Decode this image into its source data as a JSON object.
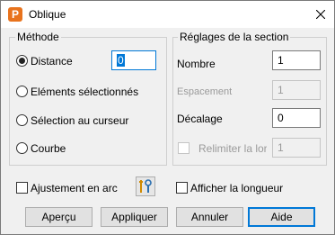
{
  "window": {
    "title": "Oblique",
    "icon_letter": "P"
  },
  "methode": {
    "title": "Méthode",
    "options": [
      {
        "label": "Distance",
        "checked": true
      },
      {
        "label": "Eléments sélectionnés",
        "checked": false
      },
      {
        "label": "Sélection au curseur",
        "checked": false
      },
      {
        "label": "Courbe",
        "checked": false
      }
    ],
    "distance_value": "0"
  },
  "reglages": {
    "title": "Réglages de la section",
    "nombre_label": "Nombre",
    "nombre_value": "1",
    "espacement_label": "Espacement",
    "espacement_value": "1",
    "decalage_label": "Décalage",
    "decalage_value": "0",
    "relimiter_label": "Relimiter la lor",
    "relimiter_value": "1"
  },
  "options": {
    "ajustement_label": "Ajustement en arc",
    "afficher_label": "Afficher la longueur"
  },
  "buttons": {
    "apercu": "Aperçu",
    "appliquer": "Appliquer",
    "annuler": "Annuler",
    "aide": "Aide"
  },
  "colors": {
    "accent": "#0078d7",
    "app_icon": "#e8731d"
  }
}
